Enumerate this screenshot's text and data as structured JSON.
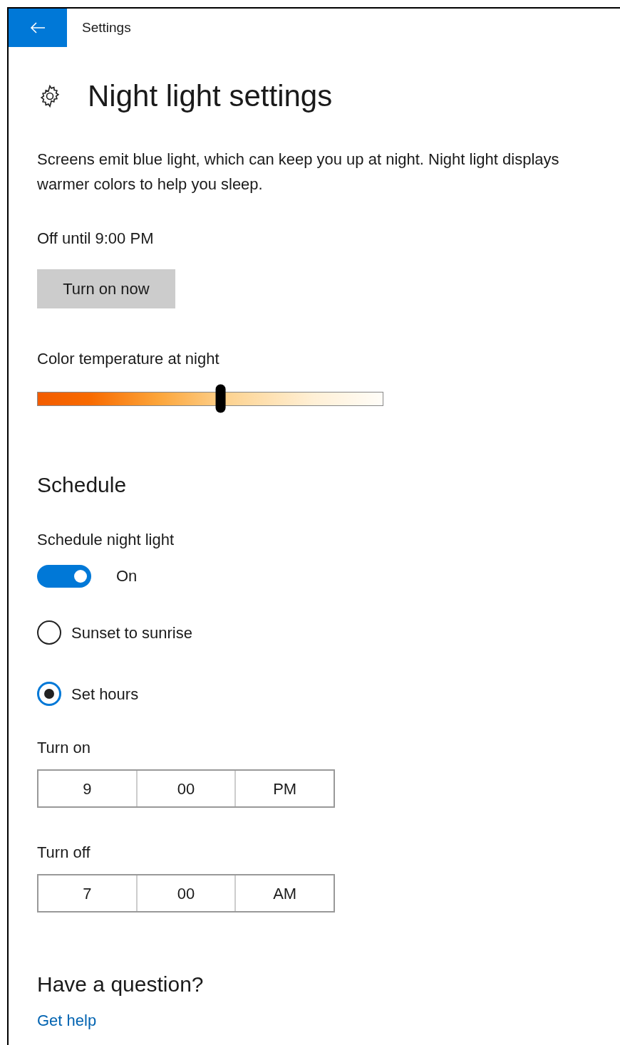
{
  "window": {
    "title": "Settings"
  },
  "page": {
    "title": "Night light settings"
  },
  "description": "Screens emit blue light, which can keep you up at night. Night light displays warmer colors to help you sleep.",
  "status": "Off until 9:00 PM",
  "turn_on_button": "Turn on now",
  "color_temperature": {
    "label": "Color temperature at night",
    "level": 0.53
  },
  "schedule": {
    "heading": "Schedule",
    "toggle": {
      "label": "Schedule night light",
      "on": true,
      "state_text": "On"
    },
    "options": [
      {
        "label": "Sunset to sunrise",
        "selected": false
      },
      {
        "label": "Set hours",
        "selected": true
      }
    ],
    "times": [
      {
        "label": "Turn on",
        "hour": "9",
        "minute": "00",
        "period": "PM"
      },
      {
        "label": "Turn off",
        "hour": "7",
        "minute": "00",
        "period": "AM"
      }
    ]
  },
  "help": {
    "heading": "Have a question?",
    "link": "Get help"
  }
}
